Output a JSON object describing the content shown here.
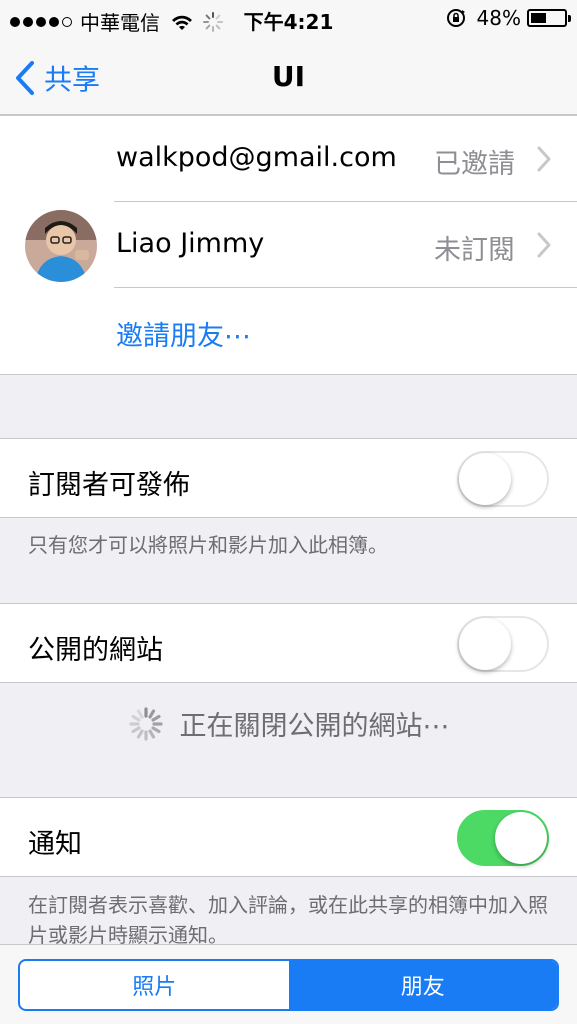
{
  "status_bar": {
    "carrier": "中華電信",
    "time": "下午4:21",
    "battery": "48%",
    "battery_level": 0.48,
    "signal_bars": 4
  },
  "nav": {
    "back_label": "共享",
    "title": "UI"
  },
  "subscribers": [
    {
      "name": "walkpod@gmail.com",
      "status": "已邀請"
    },
    {
      "name": "Liao Jimmy",
      "status": "未訂閱"
    }
  ],
  "invite_label": "邀請朋友⋯",
  "subscriber_post": {
    "label": "訂閱者可發佈",
    "on": false,
    "footnote": "只有您才可以將照片和影片加入此相簿。"
  },
  "public_site": {
    "label": "公開的網站",
    "on": false,
    "loading_text": "正在關閉公開的網站⋯"
  },
  "notifications": {
    "label": "通知",
    "on": true,
    "footnote": "在訂閱者表示喜歡、加入評論，或在此共享的相簿中加入照片或影片時顯示通知。"
  },
  "segments": {
    "photos": "照片",
    "friends": "朋友",
    "selected": "friends"
  },
  "colors": {
    "accent": "#1a7cf5",
    "switch_on": "#4cd964",
    "background": "#efeff4"
  }
}
